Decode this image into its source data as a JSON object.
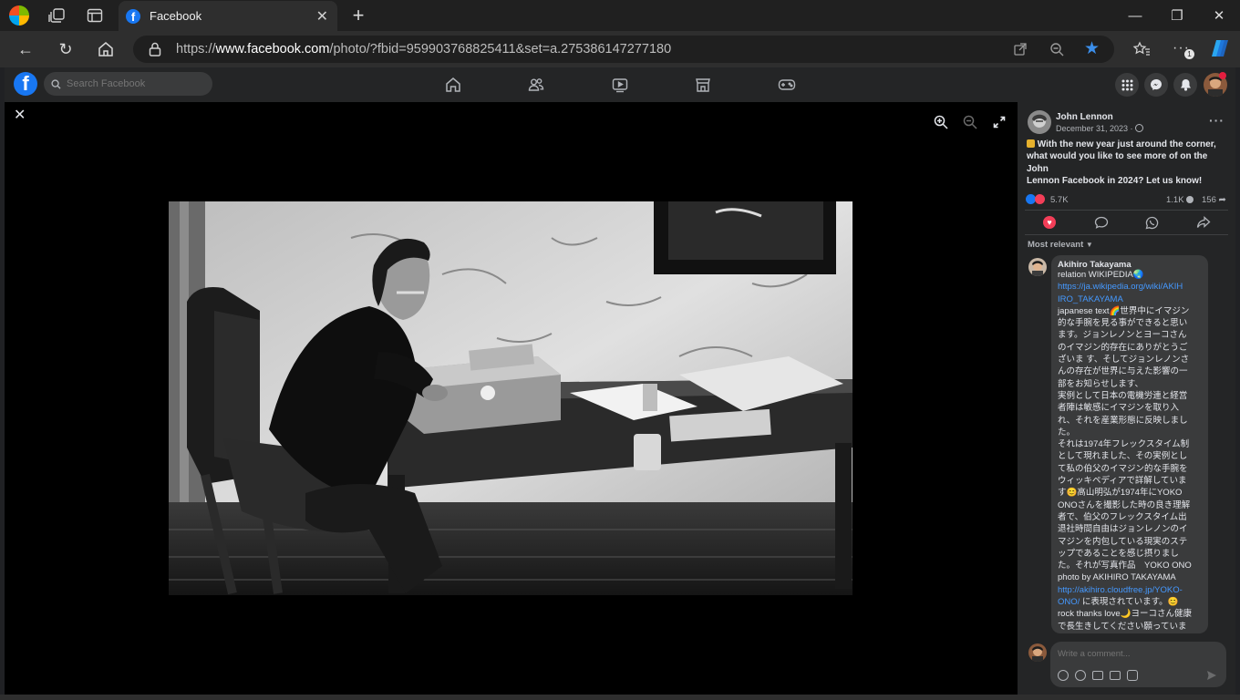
{
  "browser": {
    "tab_title": "Facebook",
    "url_prefix": "https://",
    "url_domain": "www.facebook.com",
    "url_path": "/photo/?fbid=959903768825411&set=a.275386147277180"
  },
  "facebook": {
    "search_placeholder": "Search Facebook",
    "nav_tabs": [
      "home-icon",
      "friends-icon",
      "watch-icon",
      "marketplace-icon",
      "gaming-icon"
    ]
  },
  "post": {
    "author": "John Lennon",
    "date": "December 31, 2023 ·",
    "text_line1": " With the new year just around the corner,",
    "text_line2": "what would you like to see more of on the John",
    "text_line3": "Lennon Facebook in 2024? Let us know!",
    "reactions_count": "5.7K",
    "comments_count": "1.1K",
    "shares_count": "156",
    "sort_label": "Most relevant"
  },
  "comment": {
    "author": "Akihiro Takayama",
    "lines": [
      "relation WIKIPEDIA🌏",
      "https://ja.wikipedia.org/wiki/AKIH",
      "IRO_TAKAYAMA",
      "japanese text🌈世界中にイマジン",
      "的な手腕を見る事ができると思い",
      "ます。ジョンレノンとヨーコさん",
      "のイマジン的存在にありがとうご",
      "ざいま す、そしてジョンレノンさ",
      "んの存在が世界に与えた影響の一",
      "部をお知らせします、",
      "実例として日本の電機労連と経営",
      "者陣は敏感にイマジンを取り入",
      "れ、それを産業形態に反映しまし",
      "た。",
      "それは1974年フレックスタイム制",
      "として現れました、その実例とし",
      "て私の伯父のイマジン的な手腕を",
      "ウィッキペディアで詳解していま",
      "す😊高山明弘が1974年にYOKO",
      "ONOさんを撮影した時の良き理解",
      "者で、伯父のフレックスタイム出",
      "退社時間自由はジョンレノンのイ",
      "マジンを内包している現実のステ",
      "ップであることを感じ摂りまし",
      "た。それが写真作品　YOKO ONO",
      "photo by AKIHIRO TAKAYAMA",
      "http://akihiro.cloudfree.jp/YOKO-",
      "ONO/ に表現されています。😊",
      "rock thanks love🌙ヨーコさん健康",
      "で長生きしてください願っていま"
    ],
    "link_lines": [
      1,
      2,
      26
    ],
    "link_prefix_line": 27,
    "link_prefix": "ONO/"
  },
  "composer": {
    "placeholder": "Write a comment..."
  },
  "colors": {
    "accent": "#1877f2",
    "link": "#4599ff",
    "panel_bg": "#242526",
    "photo_bg": "#000000"
  }
}
